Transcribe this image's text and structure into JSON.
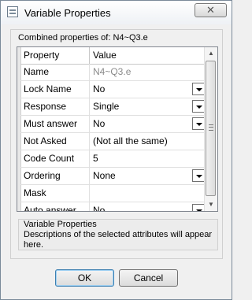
{
  "window": {
    "title": "Variable Properties",
    "close_glyph": "✕"
  },
  "combined_label": "Combined properties of: N4~Q3.e",
  "grid": {
    "headers": [
      "Property",
      "Value"
    ],
    "rows": [
      {
        "name": "Name",
        "value": "N4~Q3.e",
        "dropdown": false,
        "dim": true
      },
      {
        "name": "Lock Name",
        "value": "No",
        "dropdown": true
      },
      {
        "name": "Response",
        "value": "Single",
        "dropdown": true
      },
      {
        "name": "Must answer",
        "value": "No",
        "dropdown": true
      },
      {
        "name": "Not Asked",
        "value": "(Not all the same)",
        "dropdown": false
      },
      {
        "name": "Code Count",
        "value": "5",
        "dropdown": false
      },
      {
        "name": "Ordering",
        "value": "None",
        "dropdown": true
      },
      {
        "name": "Mask",
        "value": "",
        "dropdown": false
      },
      {
        "name": "Auto answer",
        "value": "No",
        "dropdown": true
      }
    ]
  },
  "description": {
    "title": "Variable Properties",
    "text": "Descriptions of the selected attributes will appear here."
  },
  "buttons": {
    "ok": "OK",
    "cancel": "Cancel"
  }
}
